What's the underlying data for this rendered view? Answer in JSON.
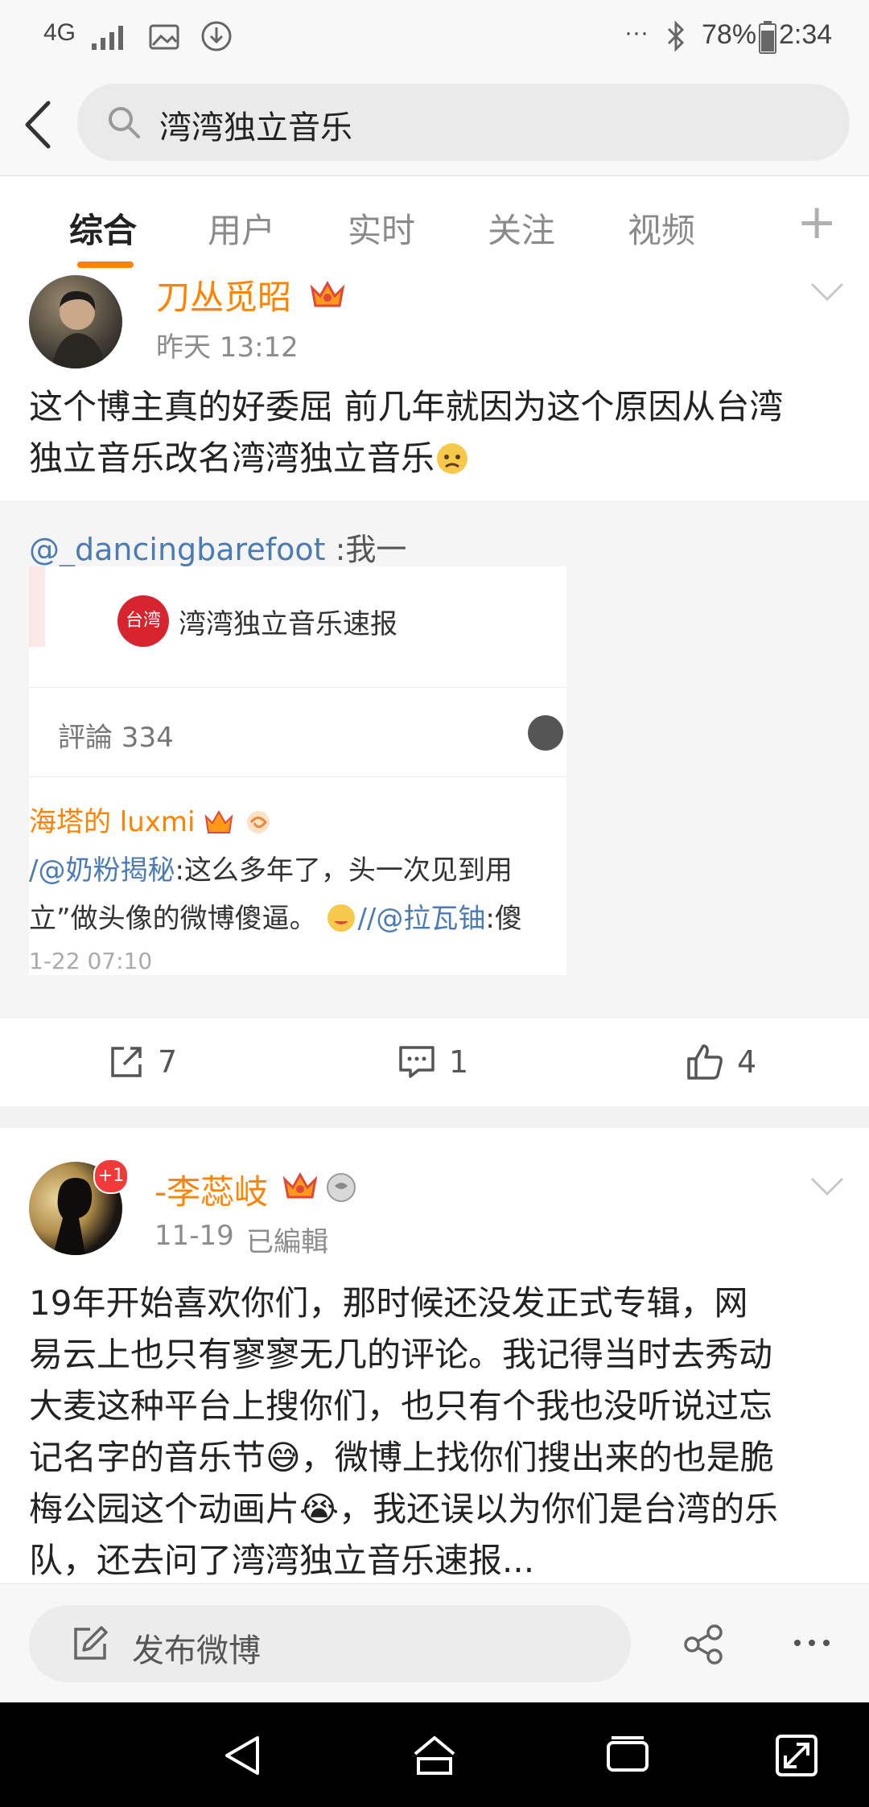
{
  "status_bar": {
    "network": "4G",
    "battery": "78%",
    "time": "2:34",
    "dots": "···"
  },
  "search": {
    "query": "湾湾独立音乐"
  },
  "tabs": [
    {
      "label": "综合",
      "active": true
    },
    {
      "label": "用户",
      "active": false
    },
    {
      "label": "实时",
      "active": false
    },
    {
      "label": "关注",
      "active": false
    },
    {
      "label": "视频",
      "active": false
    }
  ],
  "tabs_plus": "+",
  "post1": {
    "username": "刀丛觅昭",
    "time": "昨天 13:12",
    "text_line1": "这个博主真的好委屈 前几年就因为这个原因从台湾",
    "text_line2": "独立音乐改名湾湾独立音乐",
    "repost_mention": "@_dancingbarefoot",
    "repost_after": " :我一",
    "embed": {
      "logo_text": "台湾",
      "title": "湾湾独立音乐速报",
      "comments_label": "評論 334",
      "line_user": "海塔的 luxmi",
      "line2_mention": "/@奶粉揭秘",
      "line2_text": ":这么多年了，头一次见到用",
      "line3_text": "立”做头像的微博傻逼。",
      "line3_mention": "//@拉瓦铀",
      "line3_tail": ":傻",
      "date": "1-22 07:10"
    },
    "reposts": "7",
    "comments": "1",
    "likes": "4"
  },
  "post2": {
    "username": "-李蕊岐",
    "badge": "+1",
    "date": "11-19",
    "edited": "已編輯",
    "lines": [
      "19年开始喜欢你们，那时候还没发正式专辑，网",
      "易云上也只有寥寥无几的评论。我记得当时去秀动",
      "大麦这种平台上搜你们，也只有个我也没听说过忘",
      "记名字的音乐节😅，微博上找你们搜出来的也是脆",
      "梅公园这个动画片😭，我还误以为你们是台湾的乐",
      "队，还去问了湾湾独立音乐速报..."
    ]
  },
  "compose": {
    "label": "发布微博"
  },
  "colors": {
    "accent": "#ff8200",
    "link": "#4b7bb5"
  }
}
